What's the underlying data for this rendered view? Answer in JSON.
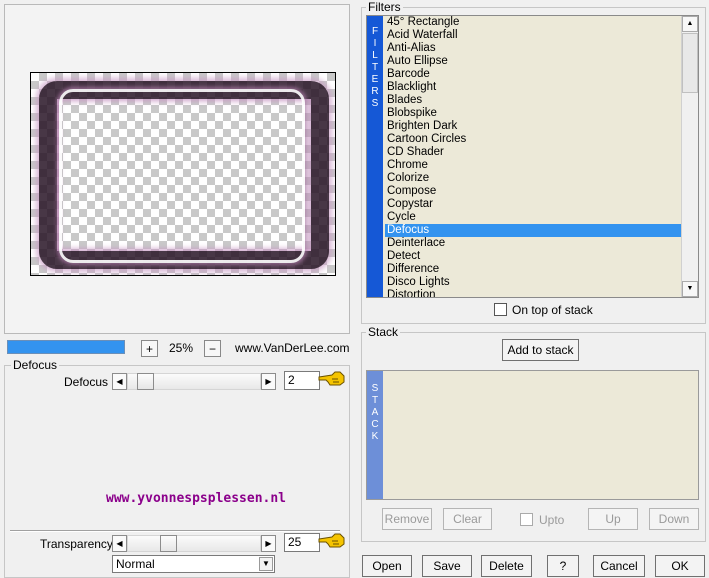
{
  "preview": {},
  "zoom": {
    "progress_fraction": 1.0,
    "plus_label": "+",
    "minus_label": "−",
    "level": "25%",
    "brand": "www.VanDerLee.com"
  },
  "filters": {
    "group_title": "Filters",
    "bar_letters": [
      "F",
      "I",
      "L",
      "T",
      "E",
      "R",
      "S"
    ],
    "items": [
      "45° Rectangle",
      "Acid Waterfall",
      "Anti-Alias",
      "Auto Ellipse",
      "Barcode",
      "Blacklight",
      "Blades",
      "Blobspike",
      "Brighten Dark",
      "Cartoon Circles",
      "CD Shader",
      "Chrome",
      "Colorize",
      "Compose",
      "Copystar",
      "Cycle",
      "Defocus",
      "Deinterlace",
      "Detect",
      "Difference",
      "Disco Lights",
      "Distortion"
    ],
    "selected": "Defocus",
    "on_top_label": "On top of stack"
  },
  "defocus": {
    "group_title": "Defocus",
    "param_label": "Defocus",
    "param_value": "2",
    "param_level": 0.05,
    "website": "www.yvonnespsplessen.nl"
  },
  "transparency": {
    "label": "Transparency",
    "value": "25",
    "level": 0.25,
    "mode": "Normal"
  },
  "stack": {
    "group_title": "Stack",
    "add_label": "Add to stack",
    "bar_letters": [
      "S",
      "T",
      "A",
      "C",
      "K"
    ],
    "remove_label": "Remove",
    "clear_label": "Clear",
    "upto_label": "Upto",
    "up_label": "Up",
    "down_label": "Down"
  },
  "footer": {
    "open": "Open",
    "save": "Save",
    "delete": "Delete",
    "help": "?",
    "cancel": "Cancel",
    "ok": "OK"
  },
  "colors": {
    "accent": "#3393ef",
    "filter_bar": "#1558d6",
    "stack_bar": "#6d8fd8",
    "website": "#8b008b"
  }
}
